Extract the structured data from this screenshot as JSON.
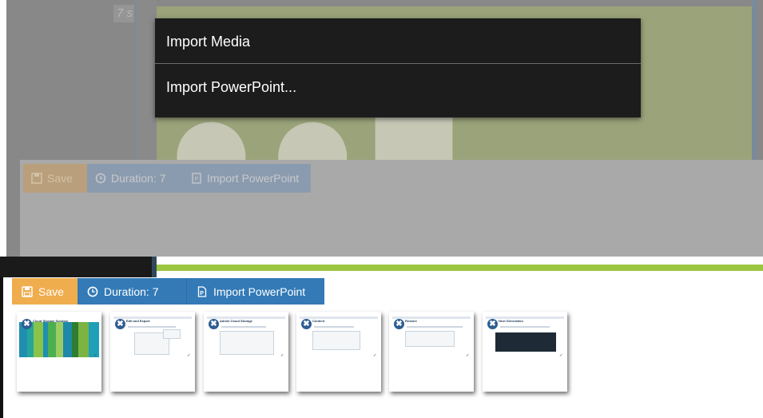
{
  "timeline": {
    "badge": "7 s"
  },
  "context_menu": {
    "items": [
      {
        "label": "Import Media"
      },
      {
        "label": "Import PowerPoint..."
      }
    ]
  },
  "toolbar": {
    "save_label": "Save",
    "duration_label": "Duration: 7",
    "import_label": "Import PowerPoint"
  },
  "slides": [
    {
      "title": "Cloud Storage Solution"
    },
    {
      "title": "Edit and Export"
    },
    {
      "title": "Admin Cloud Storage"
    },
    {
      "title": "Content"
    },
    {
      "title": "Restore"
    },
    {
      "title": "Next Generation"
    }
  ],
  "colors": {
    "save": "#f0ad4e",
    "primary": "#337ab7",
    "menu_bg": "#1c1c1c",
    "accent_green": "#9cc63f",
    "delete_badge": "#2f5e92"
  },
  "icons": {
    "save": "floppy-disk-icon",
    "duration": "clock-icon",
    "import": "powerpoint-file-icon",
    "delete": "close-icon"
  }
}
